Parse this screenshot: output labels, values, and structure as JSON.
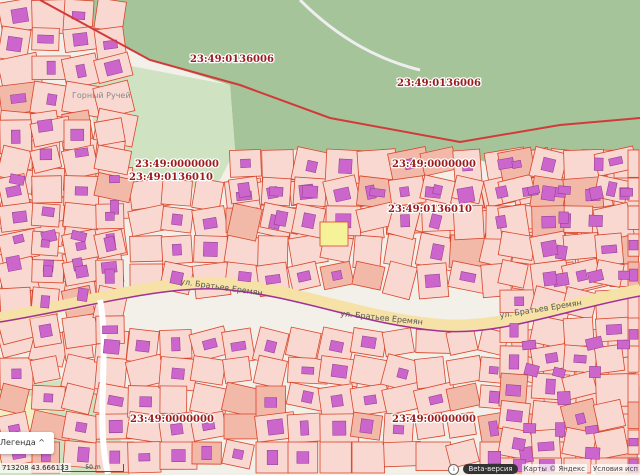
{
  "map": {
    "colors": {
      "forest": "#9fbf93",
      "parcel": "#f8d8d0",
      "parcel_stroke": "#d9452b",
      "building": "#cc66cc",
      "boundary": "#d23a3a",
      "road": "#f6e1a6",
      "route": "#a0309a",
      "highlight": "#f6f29a"
    },
    "cadastral_labels": [
      {
        "text": "23:49:0136006"
      },
      {
        "text": "23:49:0136006"
      },
      {
        "text": "23:49:0000000"
      },
      {
        "text": "23:49:0136010"
      },
      {
        "text": "23:49:0000000"
      },
      {
        "text": "23:49:0136010"
      },
      {
        "text": "23:49:0000000"
      },
      {
        "text": "23:49:0000000"
      }
    ],
    "streets": [
      {
        "text": "ул. Братьев Еремян"
      },
      {
        "text": "ул. Братьев Еремян"
      },
      {
        "text": "ул. Братьев Еремян"
      }
    ],
    "places": [
      {
        "text": "Горный Ручей"
      }
    ]
  },
  "controls": {
    "legend_label": "Легенда",
    "legend_icon": "chevron-up-icon",
    "coordinates": "713208  43.666133",
    "scale_label": "50 m",
    "info_icon": "info-icon",
    "beta_label": "Beta-версия",
    "copyright": "Карты © Яндекс",
    "terms": "Условия исп"
  }
}
